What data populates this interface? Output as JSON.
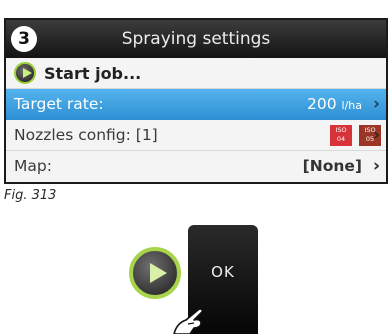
{
  "screen": {
    "step_number": "3",
    "title": "Spraying settings",
    "start_job_label": "Start job...",
    "target_rate": {
      "label": "Target rate:",
      "value": "200",
      "unit": "l/ha"
    },
    "nozzles": {
      "label": "Nozzles config:  [1]",
      "badges": [
        {
          "top": "ISO",
          "bottom": "04"
        },
        {
          "top": "ISO",
          "bottom": "05"
        }
      ]
    },
    "map": {
      "label": "Map:",
      "value": "[None]"
    },
    "chevron": "›"
  },
  "caption": "Fig. 313",
  "ok_key": {
    "label": "OK"
  },
  "colors": {
    "highlight": "#3ea0e0",
    "accent_green": "#a7d44a",
    "iso_04": "#d8333a",
    "iso_05": "#9b3525"
  }
}
